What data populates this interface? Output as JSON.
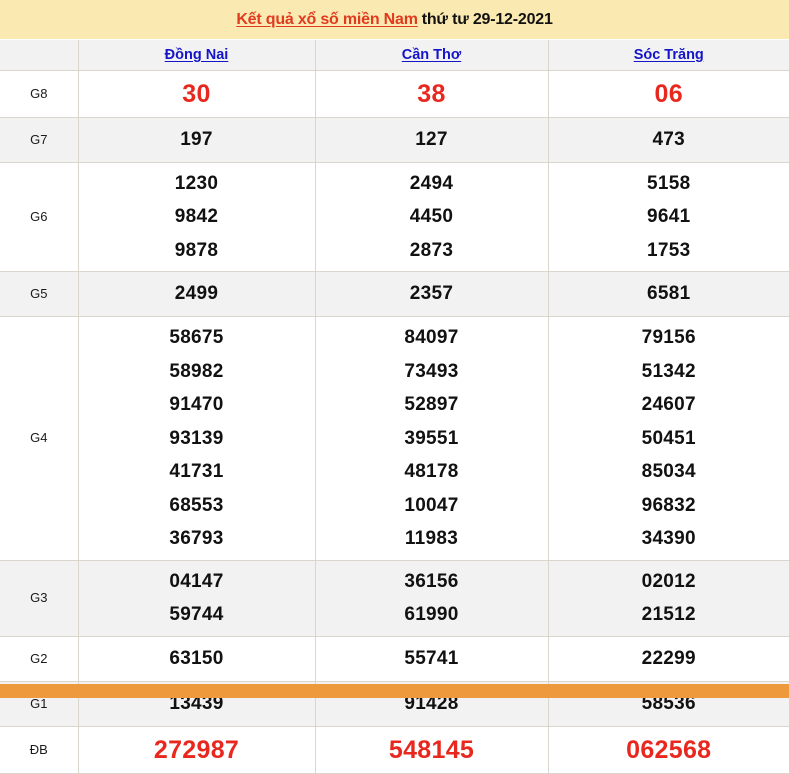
{
  "title": {
    "main": "Kết quả xổ số miền Nam",
    "sub": "thứ tư 29-12-2021"
  },
  "colors": {
    "title_bg": "#FAE9B0",
    "title_main": "#E03A20",
    "province_link": "#1414C8",
    "highlight_red": "#E8281E",
    "stripe_bg": "#F2F2F2",
    "border": "#DAD6CC",
    "bottom_bar": "#EE9A3C"
  },
  "table": {
    "corner_label": "",
    "columns": [
      "Đồng Nai",
      "Cần Thơ",
      "Sóc Trăng"
    ],
    "rows": [
      {
        "label": "G8",
        "style": "red",
        "stripe": false,
        "cells": [
          [
            "30"
          ],
          [
            "38"
          ],
          [
            "06"
          ]
        ]
      },
      {
        "label": "G7",
        "style": "normal",
        "stripe": true,
        "cells": [
          [
            "197"
          ],
          [
            "127"
          ],
          [
            "473"
          ]
        ]
      },
      {
        "label": "G6",
        "style": "normal",
        "stripe": false,
        "cells": [
          [
            "1230",
            "9842",
            "9878"
          ],
          [
            "2494",
            "4450",
            "2873"
          ],
          [
            "5158",
            "9641",
            "1753"
          ]
        ]
      },
      {
        "label": "G5",
        "style": "normal",
        "stripe": true,
        "cells": [
          [
            "2499"
          ],
          [
            "2357"
          ],
          [
            "6581"
          ]
        ]
      },
      {
        "label": "G4",
        "style": "normal",
        "stripe": false,
        "cells": [
          [
            "58675",
            "58982",
            "91470",
            "93139",
            "41731",
            "68553",
            "36793"
          ],
          [
            "84097",
            "73493",
            "52897",
            "39551",
            "48178",
            "10047",
            "11983"
          ],
          [
            "79156",
            "51342",
            "24607",
            "50451",
            "85034",
            "96832",
            "34390"
          ]
        ]
      },
      {
        "label": "G3",
        "style": "normal",
        "stripe": true,
        "cells": [
          [
            "04147",
            "59744"
          ],
          [
            "36156",
            "61990"
          ],
          [
            "02012",
            "21512"
          ]
        ]
      },
      {
        "label": "G2",
        "style": "normal",
        "stripe": false,
        "cells": [
          [
            "63150"
          ],
          [
            "55741"
          ],
          [
            "22299"
          ]
        ]
      },
      {
        "label": "G1",
        "style": "normal",
        "stripe": true,
        "cells": [
          [
            "13439"
          ],
          [
            "91428"
          ],
          [
            "58536"
          ]
        ]
      },
      {
        "label": "ĐB",
        "style": "red",
        "stripe": false,
        "cells": [
          [
            "272987"
          ],
          [
            "548145"
          ],
          [
            "062568"
          ]
        ]
      }
    ]
  }
}
